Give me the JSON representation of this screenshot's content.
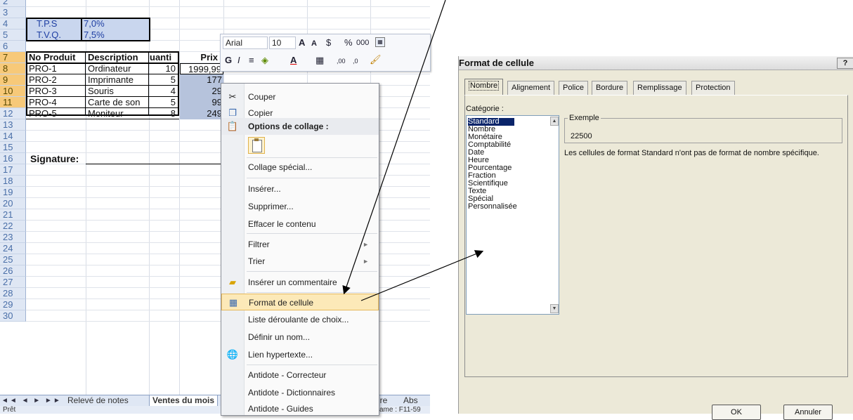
{
  "sheet": {
    "rows": [
      {
        "num": "2"
      },
      {
        "num": "3"
      },
      {
        "num": "4"
      },
      {
        "num": "5"
      },
      {
        "num": "6"
      },
      {
        "num": "7"
      },
      {
        "num": "8"
      },
      {
        "num": "9"
      },
      {
        "num": "10"
      },
      {
        "num": "11"
      },
      {
        "num": "12"
      },
      {
        "num": "13"
      },
      {
        "num": "14"
      },
      {
        "num": "15"
      },
      {
        "num": "16"
      },
      {
        "num": "17"
      },
      {
        "num": "18"
      },
      {
        "num": "19"
      },
      {
        "num": "20"
      },
      {
        "num": "21"
      },
      {
        "num": "22"
      },
      {
        "num": "23"
      },
      {
        "num": "24"
      },
      {
        "num": "25"
      },
      {
        "num": "26"
      },
      {
        "num": "27"
      },
      {
        "num": "28"
      },
      {
        "num": "29"
      },
      {
        "num": "30"
      }
    ],
    "taxes": [
      {
        "name": "T.P.S",
        "rate": "7,0%"
      },
      {
        "name": "T.V.Q.",
        "rate": "7,5%"
      }
    ],
    "headers": {
      "product": "No Produit",
      "description": "Description",
      "quantity": "uanti",
      "price": "Prix"
    },
    "products": [
      {
        "id": "PRO-1",
        "description": "Ordinateur",
        "qty": "10",
        "price": "1999,99"
      },
      {
        "id": "PRO-2",
        "description": "Imprimante",
        "qty": "5",
        "price": "177"
      },
      {
        "id": "PRO-3",
        "description": "Souris",
        "qty": "4",
        "price": "29"
      },
      {
        "id": "PRO-4",
        "description": "Carte de son",
        "qty": "5",
        "price": "99"
      },
      {
        "id": "PRO-5",
        "description": "Moniteur",
        "qty": "8",
        "price": "249"
      }
    ],
    "signature": "Signature:",
    "tabs": [
      "Relevé de notes",
      "Ventes du mois",
      "toire",
      "Abs"
    ],
    "status_left": "Prêt",
    "status_right": "ame : F11-59"
  },
  "mini_toolbar": {
    "font": "Arial",
    "size": "10",
    "grow": "A",
    "shrink": "A",
    "currency": "$",
    "percent": "%",
    "thousands": "000",
    "bold": "G",
    "italic": "I",
    "align": "≡",
    "fill": "A",
    "increase_dec": ",00",
    "decrease_dec": ",0"
  },
  "context_menu": {
    "items": [
      {
        "label": "Couper",
        "icon": "scissors-icon"
      },
      {
        "label": "Copier",
        "icon": "copy-icon"
      },
      {
        "label": "Options de collage :",
        "icon": "paste-icon"
      },
      {
        "label": "Collage spécial..."
      },
      {
        "label": "Insérer..."
      },
      {
        "label": "Supprimer..."
      },
      {
        "label": "Effacer le contenu"
      },
      {
        "label": "Filtrer"
      },
      {
        "label": "Trier"
      },
      {
        "label": "Insérer un commentaire",
        "icon": "comment-icon"
      },
      {
        "label": "Format de cellule",
        "icon": "format-cells-icon"
      },
      {
        "label": "Liste déroulante de choix..."
      },
      {
        "label": "Définir un nom..."
      },
      {
        "label": "Lien hypertexte...",
        "icon": "hyperlink-icon"
      },
      {
        "label": "Antidote - Correcteur"
      },
      {
        "label": "Antidote - Dictionnaires"
      },
      {
        "label": "Antidote - Guides"
      }
    ]
  },
  "dialog": {
    "title": "Format de cellule",
    "help": "?",
    "tabs": [
      "Nombre",
      "Alignement",
      "Police",
      "Bordure",
      "Remplissage",
      "Protection"
    ],
    "category_label": "Catégorie :",
    "categories": [
      "Standard",
      "Nombre",
      "Monétaire",
      "Comptabilité",
      "Date",
      "Heure",
      "Pourcentage",
      "Fraction",
      "Scientifique",
      "Texte",
      "Spécial",
      "Personnalisée"
    ],
    "example_label": "Exemple",
    "example_value": "22500",
    "description": "Les cellules de format Standard n'ont pas de format de nombre spécifique.",
    "ok": "OK",
    "cancel": "Annuler"
  },
  "colors": {
    "selection_blue": "#0a246a",
    "menu_hover": "#fce9b8",
    "tax_text": "#1f3fa3"
  }
}
